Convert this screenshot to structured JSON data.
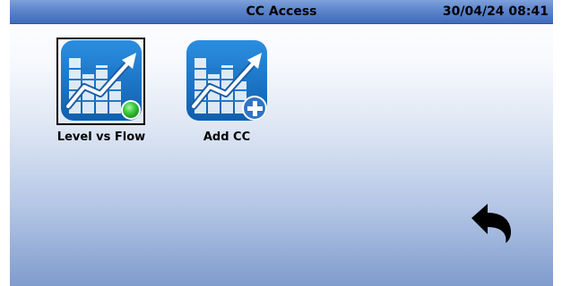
{
  "header": {
    "title": "CC Access",
    "datetime": "30/04/24 08:41"
  },
  "apps": [
    {
      "label": "Level vs Flow",
      "icon": "chart-trend-icon",
      "badge": "green-status-dot",
      "selected": true
    },
    {
      "label": "Add CC",
      "icon": "chart-trend-icon",
      "badge": "add-icon",
      "selected": false
    }
  ],
  "navigation": {
    "back_icon": "back-arrow-icon"
  },
  "colors": {
    "title_bar": "#4f79c4",
    "icon_blue": "#1a73c9",
    "status_green": "#35c23a"
  }
}
